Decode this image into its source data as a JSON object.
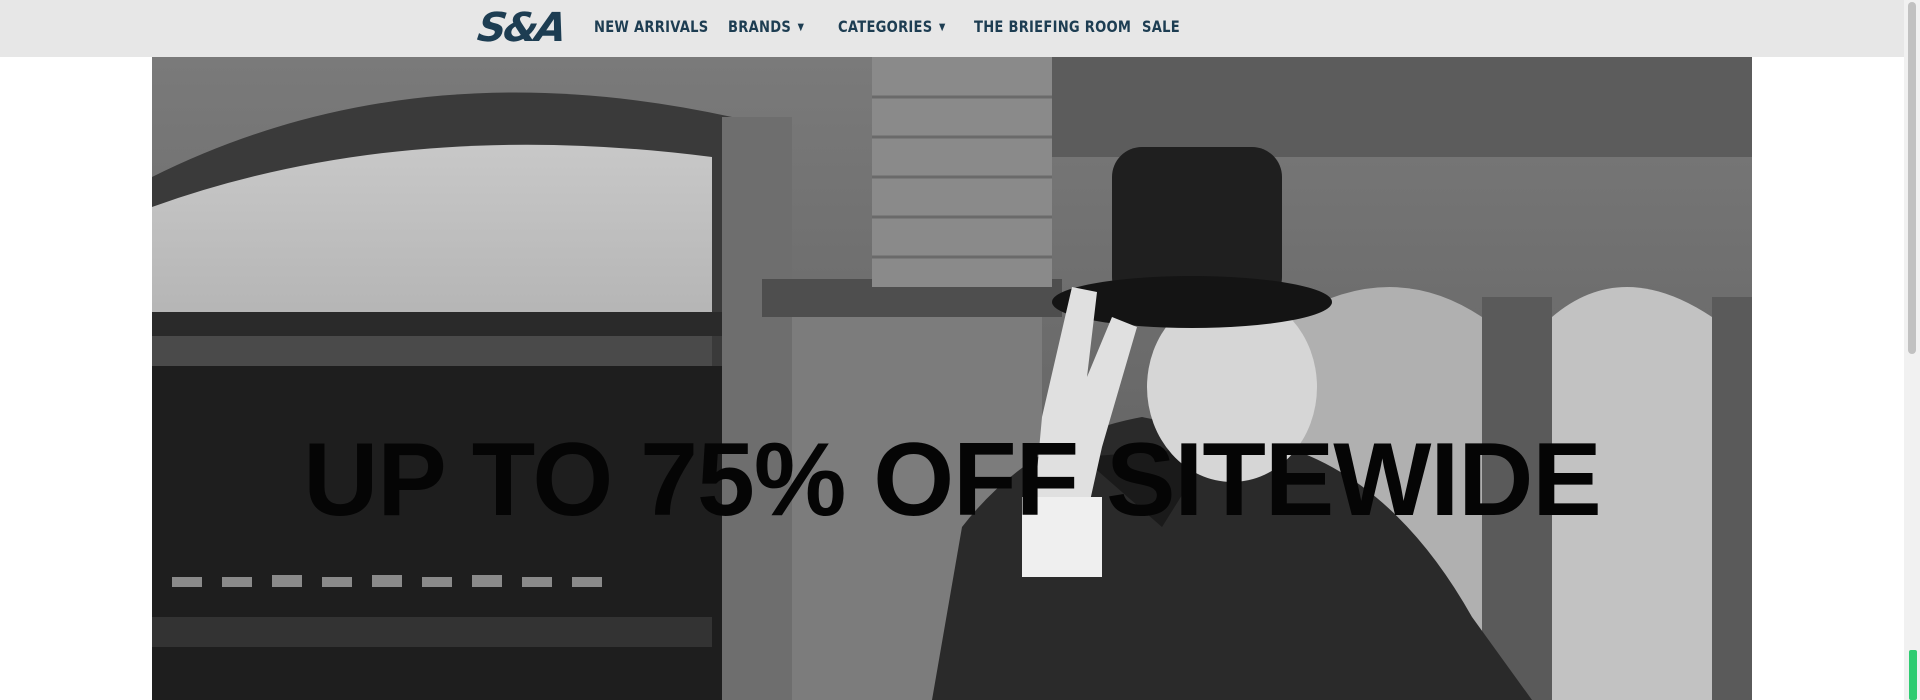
{
  "brand": {
    "logo_text": "S&A"
  },
  "nav": {
    "items": [
      {
        "label": "NEW ARRIVALS",
        "has_dropdown": false
      },
      {
        "label": "BRANDS",
        "has_dropdown": true
      },
      {
        "label": "CATEGORIES",
        "has_dropdown": true
      },
      {
        "label": "THE BRIEFING ROOM",
        "has_dropdown": false
      },
      {
        "label": "SALE",
        "has_dropdown": false
      }
    ],
    "dropdown_glyph": "▼"
  },
  "hero": {
    "headline": "UP TO 75% OFF SITEWIDE",
    "image_description_icon": "photo-man-top-hat-v-sign"
  },
  "colors": {
    "nav_background": "#e7e7e7",
    "nav_text": "#1d3d52",
    "headline": "#050505",
    "scroll_indicator": "#2ecc71"
  }
}
